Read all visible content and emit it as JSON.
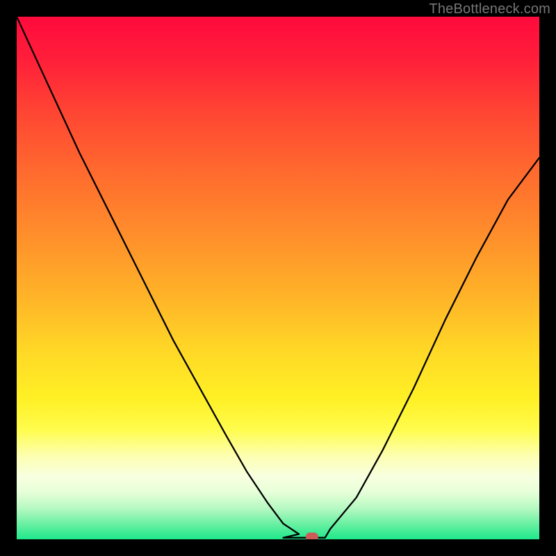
{
  "watermark": "TheBottleneck.com",
  "chart_data": {
    "type": "line",
    "title": "",
    "xlabel": "",
    "ylabel": "",
    "xlim": [
      0,
      1
    ],
    "ylim": [
      0,
      1
    ],
    "series": [
      {
        "name": "bottleneck-curve",
        "x": [
          0.0,
          0.06,
          0.12,
          0.18,
          0.24,
          0.3,
          0.35,
          0.4,
          0.44,
          0.48,
          0.51,
          0.54,
          0.57,
          0.6,
          0.65,
          0.7,
          0.76,
          0.82,
          0.88,
          0.94,
          1.0
        ],
        "values": [
          1.0,
          0.87,
          0.74,
          0.62,
          0.5,
          0.38,
          0.29,
          0.2,
          0.13,
          0.07,
          0.03,
          0.01,
          0.0,
          0.02,
          0.08,
          0.17,
          0.29,
          0.42,
          0.54,
          0.65,
          0.73
        ]
      }
    ],
    "marker": {
      "x": 0.565,
      "y": 0.005,
      "label": ""
    },
    "flat_segment": {
      "x0": 0.51,
      "x1": 0.59,
      "y": 0.003
    },
    "colors": {
      "curve": "#000000",
      "marker": "#cf5a5a",
      "background_top": "#ff0a3c",
      "background_bottom": "#1ee88a"
    }
  }
}
